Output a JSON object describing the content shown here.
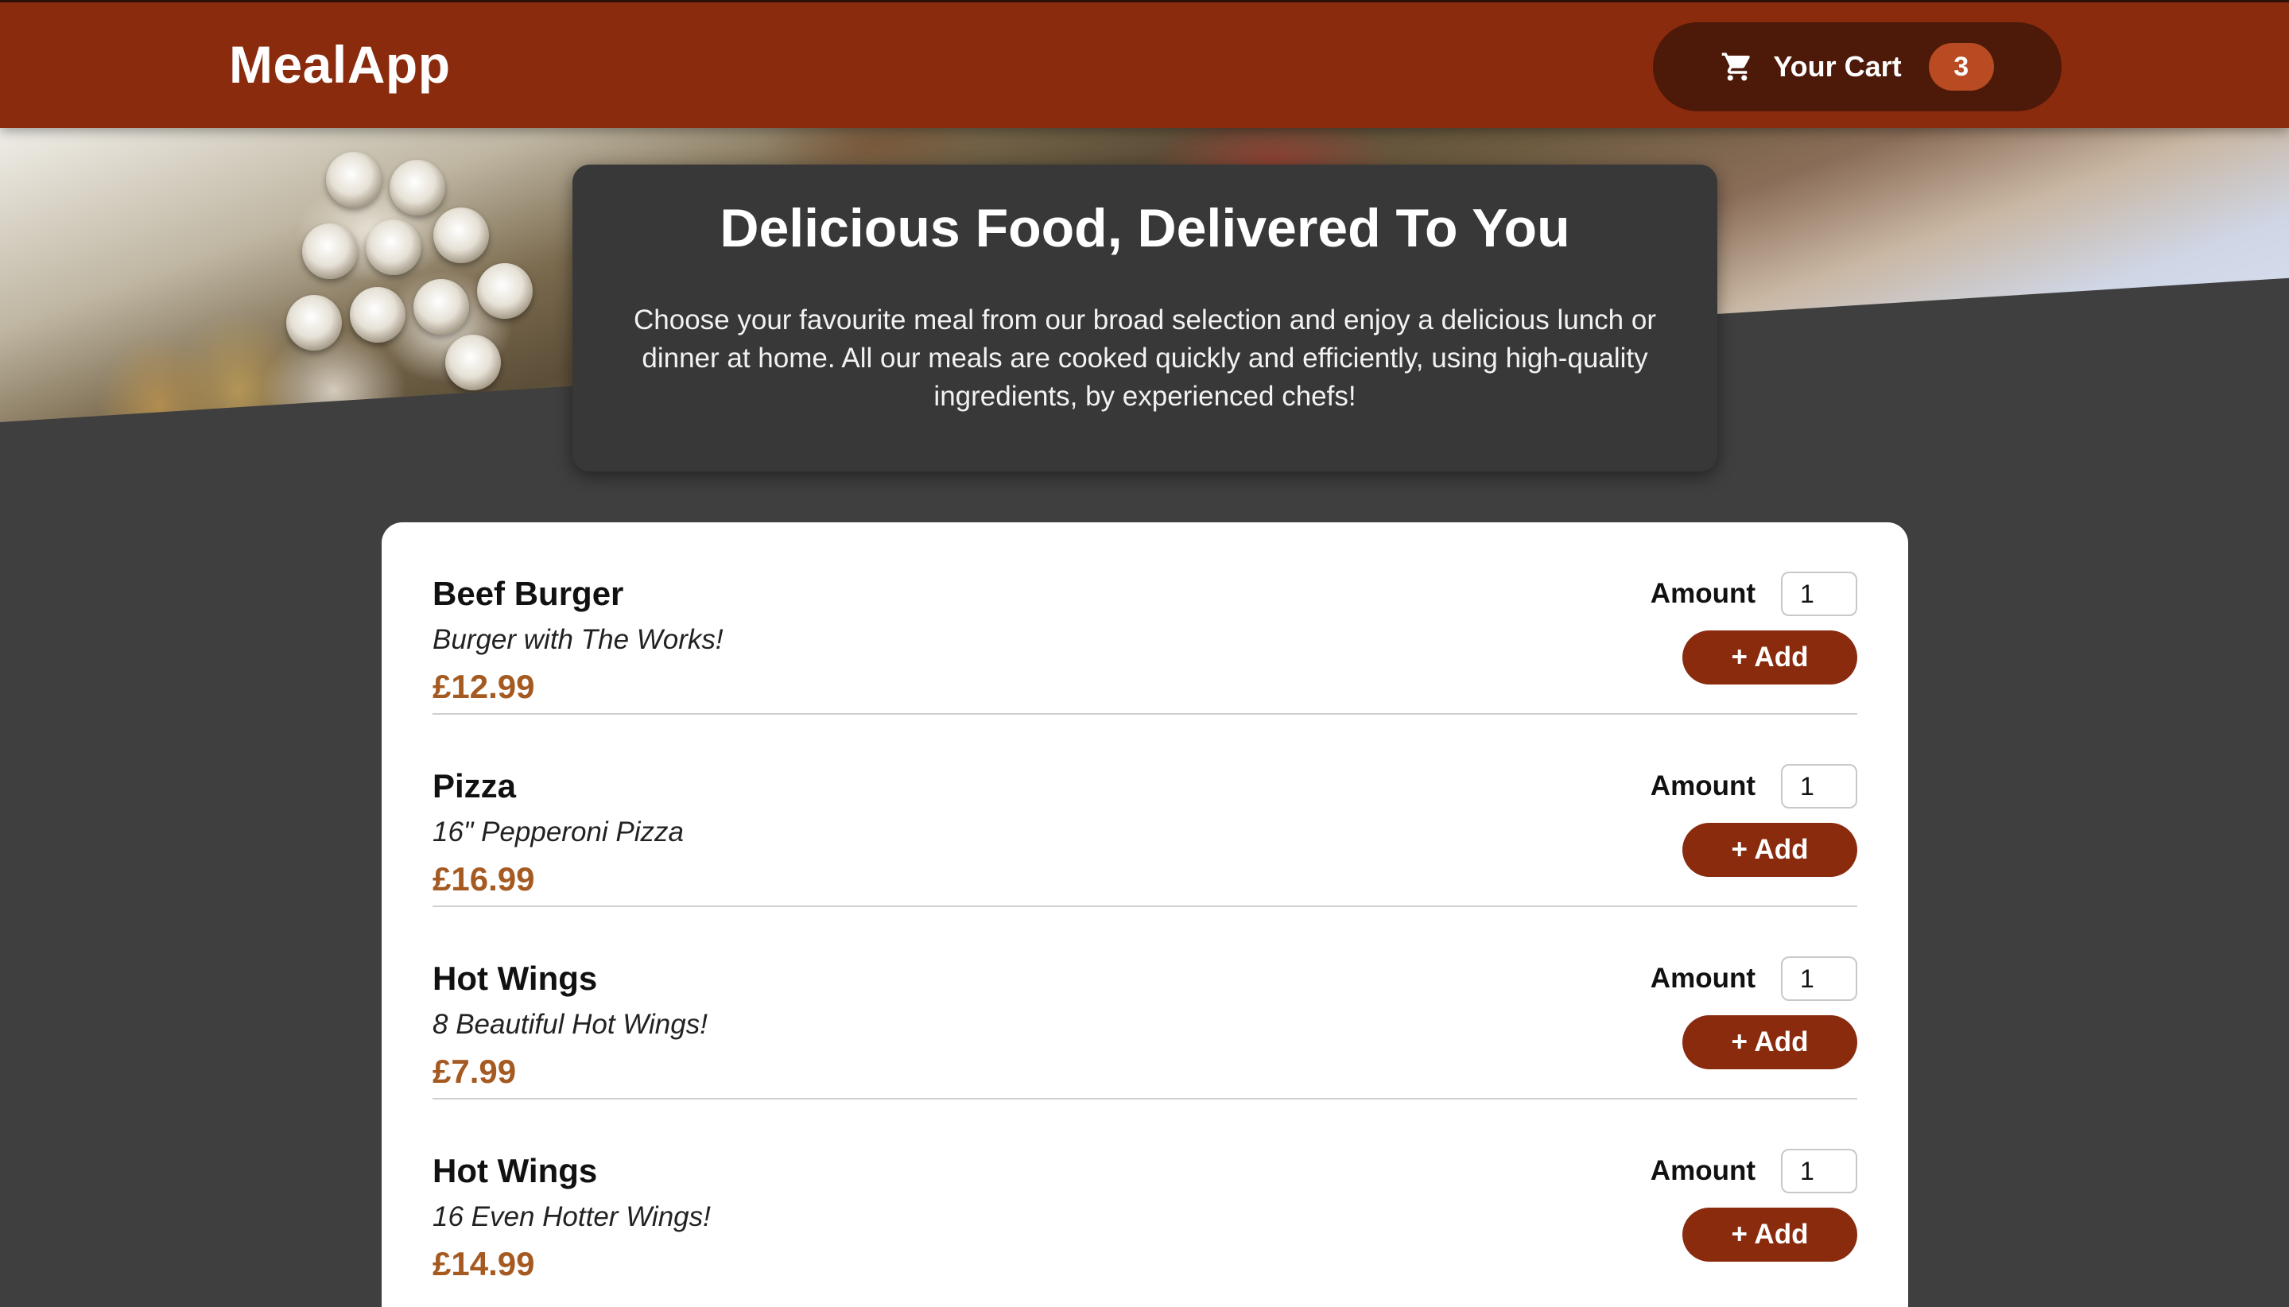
{
  "header": {
    "brand": "MealApp",
    "cart": {
      "label": "Your Cart",
      "count": "3",
      "icon": "cart-icon"
    }
  },
  "summary": {
    "title": "Delicious Food, Delivered To You",
    "text": "Choose your favourite meal from our broad selection and enjoy a delicious lunch or dinner at home. All our meals are cooked quickly and efficiently, using high-quality ingredients, by experienced chefs!"
  },
  "meals": [
    {
      "name": "Beef Burger",
      "description": "Burger with The Works!",
      "price": "£12.99",
      "amount_label": "Amount",
      "amount": "1",
      "add_label": "+ Add"
    },
    {
      "name": "Pizza",
      "description": "16\" Pepperoni Pizza",
      "price": "£16.99",
      "amount_label": "Amount",
      "amount": "1",
      "add_label": "+ Add"
    },
    {
      "name": "Hot Wings",
      "description": "8 Beautiful Hot Wings!",
      "price": "£7.99",
      "amount_label": "Amount",
      "amount": "1",
      "add_label": "+ Add"
    },
    {
      "name": "Hot Wings",
      "description": "16 Even Hotter Wings!",
      "price": "£14.99",
      "amount_label": "Amount",
      "amount": "1",
      "add_label": "+ Add"
    }
  ],
  "colors": {
    "header": "#8a2b0e",
    "cart_button": "#4d1908",
    "badge": "#b94b23",
    "price": "#a55a21",
    "background": "#3f3f3f"
  }
}
